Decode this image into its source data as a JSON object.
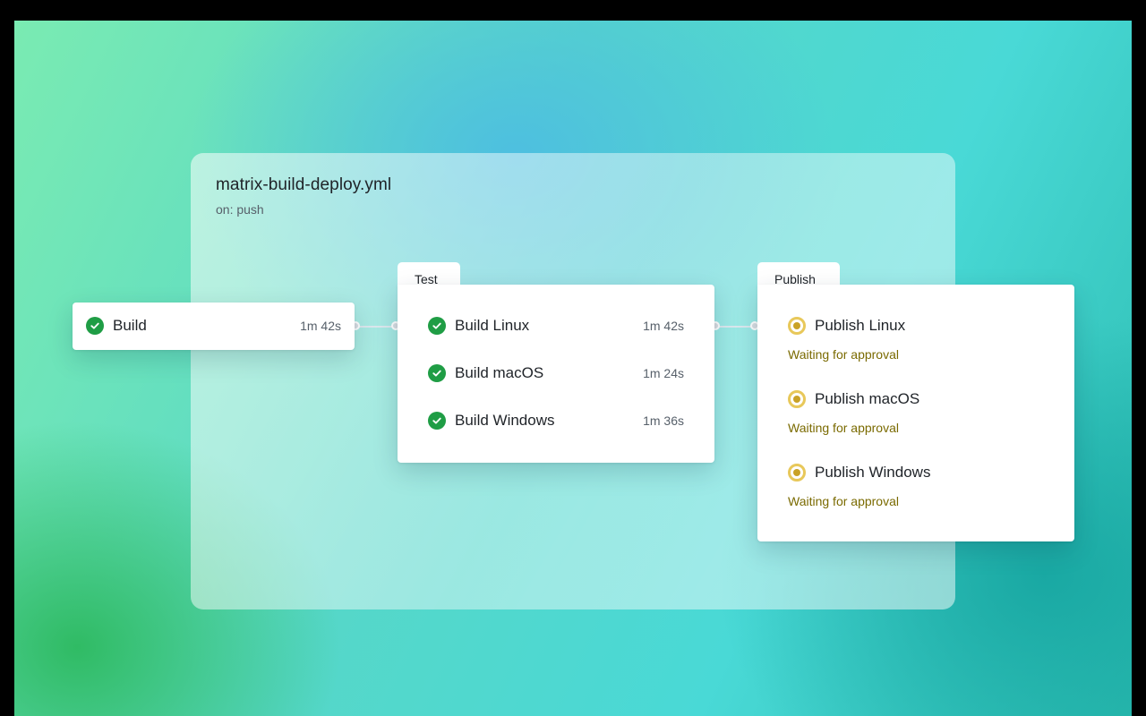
{
  "workflow": {
    "title": "matrix-build-deploy.yml",
    "trigger": "on: push"
  },
  "build_job": {
    "name": "Build",
    "duration": "1m 42s",
    "status": "success"
  },
  "test_stage": {
    "tab_label": "Test",
    "jobs": [
      {
        "name": "Build Linux",
        "duration": "1m 42s",
        "status": "success"
      },
      {
        "name": "Build macOS",
        "duration": "1m 24s",
        "status": "success"
      },
      {
        "name": "Build Windows",
        "duration": "1m 36s",
        "status": "success"
      }
    ]
  },
  "publish_stage": {
    "tab_label": "Publish",
    "jobs": [
      {
        "name": "Publish Linux",
        "status_text": "Waiting for approval",
        "status": "waiting"
      },
      {
        "name": "Publish macOS",
        "status_text": "Waiting for approval",
        "status": "waiting"
      },
      {
        "name": "Publish Windows",
        "status_text": "Waiting for approval",
        "status": "waiting"
      }
    ]
  },
  "icons": {
    "success": "check-circle-icon",
    "waiting": "pending-dot-icon"
  },
  "colors": {
    "success": "#1f9d45",
    "waiting_ring": "#e8c85a",
    "waiting_dot": "#c9a227",
    "waiting_text": "#7a6a00"
  }
}
